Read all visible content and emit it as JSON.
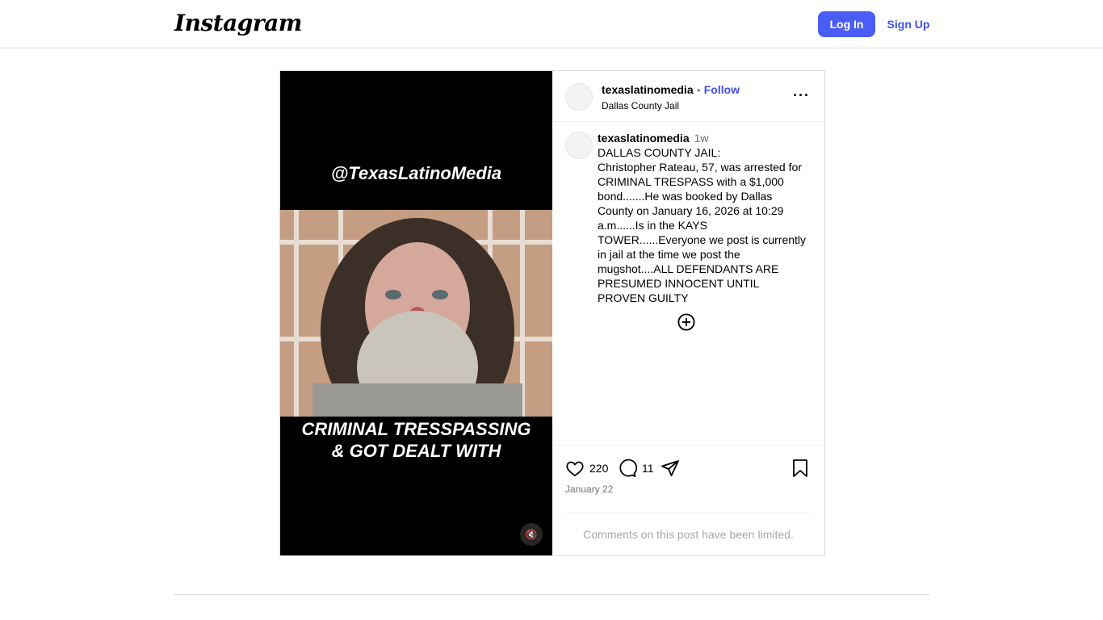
{
  "header": {
    "logo": "Instagram",
    "login_label": "Log In",
    "signup_label": "Sign Up"
  },
  "post": {
    "media": {
      "handle_text": "@TexasLatinoMedia",
      "caption_overlay": "CRIMINAL TRESSPASSING & GOT DEALT WITH",
      "mute_icon": "speaker-muted-icon"
    },
    "header": {
      "username": "texaslatinomedia",
      "dot": "•",
      "follow_label": "Follow",
      "location": "Dallas County Jail",
      "more_icon": "more-dots-icon"
    },
    "caption": {
      "username": "texaslatinomedia",
      "time": "1w",
      "text": "DALLAS COUNTY JAIL:\nChristopher Rateau, 57, was arrested for CRIMINAL TRESPASS with a $1,000 bond.......He was booked by Dallas County on January 16, 2026 at 10:29 a.m......Is in the KAYS TOWER......Everyone we post is currently in jail at the time we post the mugshot....ALL DEFENDANTS ARE PRESUMED INNOCENT UNTIL PROVEN GUILTY"
    },
    "actions": {
      "likes": "220",
      "comments": "11",
      "date": "January 22"
    },
    "comments_limited": "Comments on this post have been limited."
  },
  "colors": {
    "accent": "#4a5df9",
    "link": "#4150f7",
    "muted": "#737373",
    "border": "#dbdbdb"
  }
}
